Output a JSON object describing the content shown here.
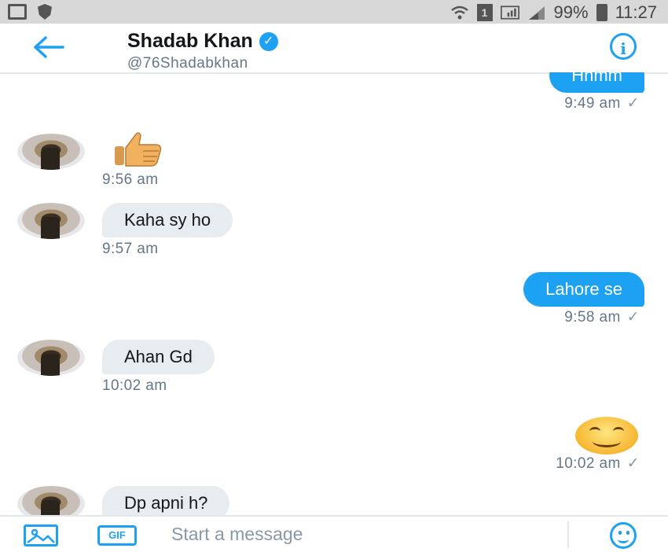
{
  "status_bar": {
    "battery": "99%",
    "time": "11:27",
    "sim_label": "1"
  },
  "header": {
    "name": "Shadab Khan",
    "handle": "@76Shadabkhan",
    "verified_icon": "verified-badge-icon",
    "info_icon": "i"
  },
  "colors": {
    "accent": "#1da1f2",
    "incoming_bubble": "#e6ecf0",
    "meta_text": "#657786"
  },
  "messages": [
    {
      "direction": "outgoing",
      "text": "Hhmm",
      "time": "9:49 am",
      "status": "✓"
    },
    {
      "direction": "incoming",
      "emoji": "thumbs-up",
      "time": "9:56 am"
    },
    {
      "direction": "incoming",
      "text": "Kaha sy ho",
      "time": "9:57 am"
    },
    {
      "direction": "outgoing",
      "text": "Lahore se",
      "time": "9:58 am",
      "status": "✓"
    },
    {
      "direction": "incoming",
      "text": "Ahan Gd",
      "time": "10:02 am"
    },
    {
      "direction": "outgoing",
      "emoji": "smiling-face",
      "time": "10:02 am",
      "status": "✓"
    },
    {
      "direction": "incoming",
      "text": "Dp apni h?"
    }
  ],
  "composer": {
    "placeholder": "Start a message",
    "gif_label": "GIF",
    "image_icon": "image-icon",
    "emoji_icon": "emoji-icon"
  }
}
